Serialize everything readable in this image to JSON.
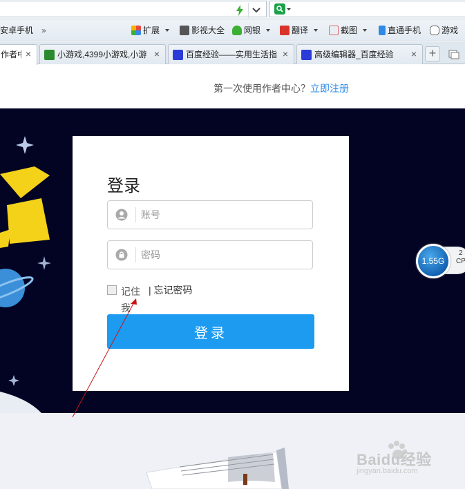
{
  "search_bar": {
    "placeholder": ""
  },
  "bookmarks": {
    "android_phone": "安卓手机",
    "more": "»",
    "extensions": "扩展",
    "video": "影视大全",
    "online_bank": "网银",
    "translate": "翻译",
    "screenshot": "截图",
    "phone_connect": "直通手机",
    "games": "游戏"
  },
  "tabs": [
    {
      "label": "作者中",
      "active": true
    },
    {
      "label": "小游戏,4399小游戏,小游",
      "active": false
    },
    {
      "label": "百度经验——实用生活指",
      "active": false
    },
    {
      "label": "高级编辑器_百度经验",
      "active": false
    }
  ],
  "page": {
    "first_time_hint": "第一次使用作者中心？",
    "register_link": "立即注册"
  },
  "login": {
    "title": "登录",
    "account_placeholder": "账号",
    "password_placeholder": "密码",
    "remember_label": "记住我",
    "forgot_password": "| 忘记密码",
    "submit_label": "登录"
  },
  "widget": {
    "memory": "1.55G",
    "cpu_label": "CP"
  },
  "watermark": {
    "brand": "Baidu经验",
    "url": "jingyan.baidu.com"
  },
  "colors": {
    "accent": "#1d9bf0",
    "banner_bg": "#030424",
    "link": "#2a8ae6"
  }
}
